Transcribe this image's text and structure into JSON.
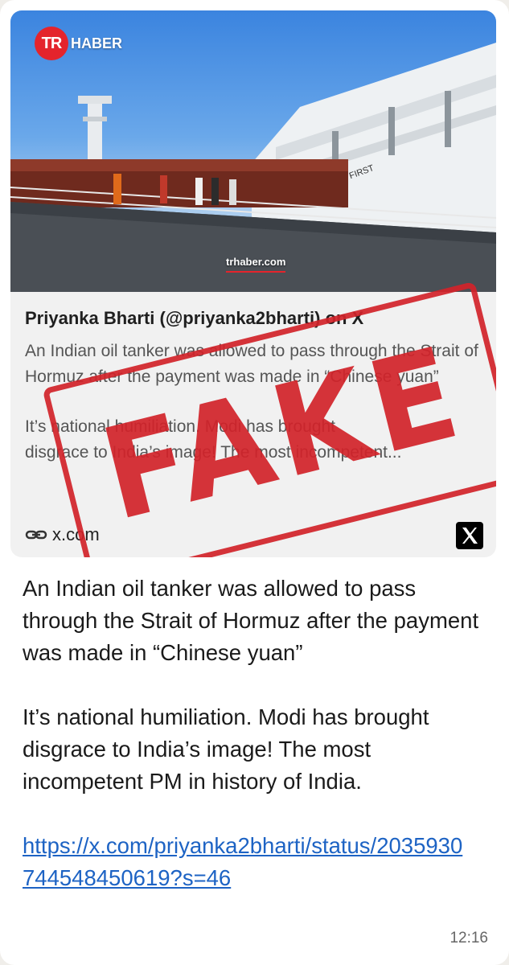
{
  "preview": {
    "source_logo": {
      "tr": "TR",
      "haber": "HABER"
    },
    "watermark": "trhaber.com",
    "title": "Priyanka Bharti (@priyanka2bharti) on X",
    "desc_line1": "An Indian oil tanker was allowed to pass through the Strait of Hormuz after the payment was made in “Chinese yuan”",
    "desc_line2a": "It’s national humiliation. Modi has brought",
    "desc_line2b": "disgrace to India’s image! The most incompetent...",
    "domain": "x.com",
    "link_icon": "link-icon",
    "platform_icon": "x-logo-icon"
  },
  "stamp": {
    "text": "FAKE",
    "color": "#d2232a"
  },
  "message": {
    "para1": "An Indian oil tanker was allowed to pass through the Strait of Hormuz after the payment was made in “Chinese yuan”",
    "para2": "It’s national humiliation. Modi has brought disgrace to India’s image! The most incompetent PM in history of India.",
    "link": "https://x.com/priyanka2bharti/status/2035930744548450619?s=46",
    "time": "12:16"
  },
  "colors": {
    "link": "#1d63c4",
    "brand_red": "#e4242c"
  }
}
